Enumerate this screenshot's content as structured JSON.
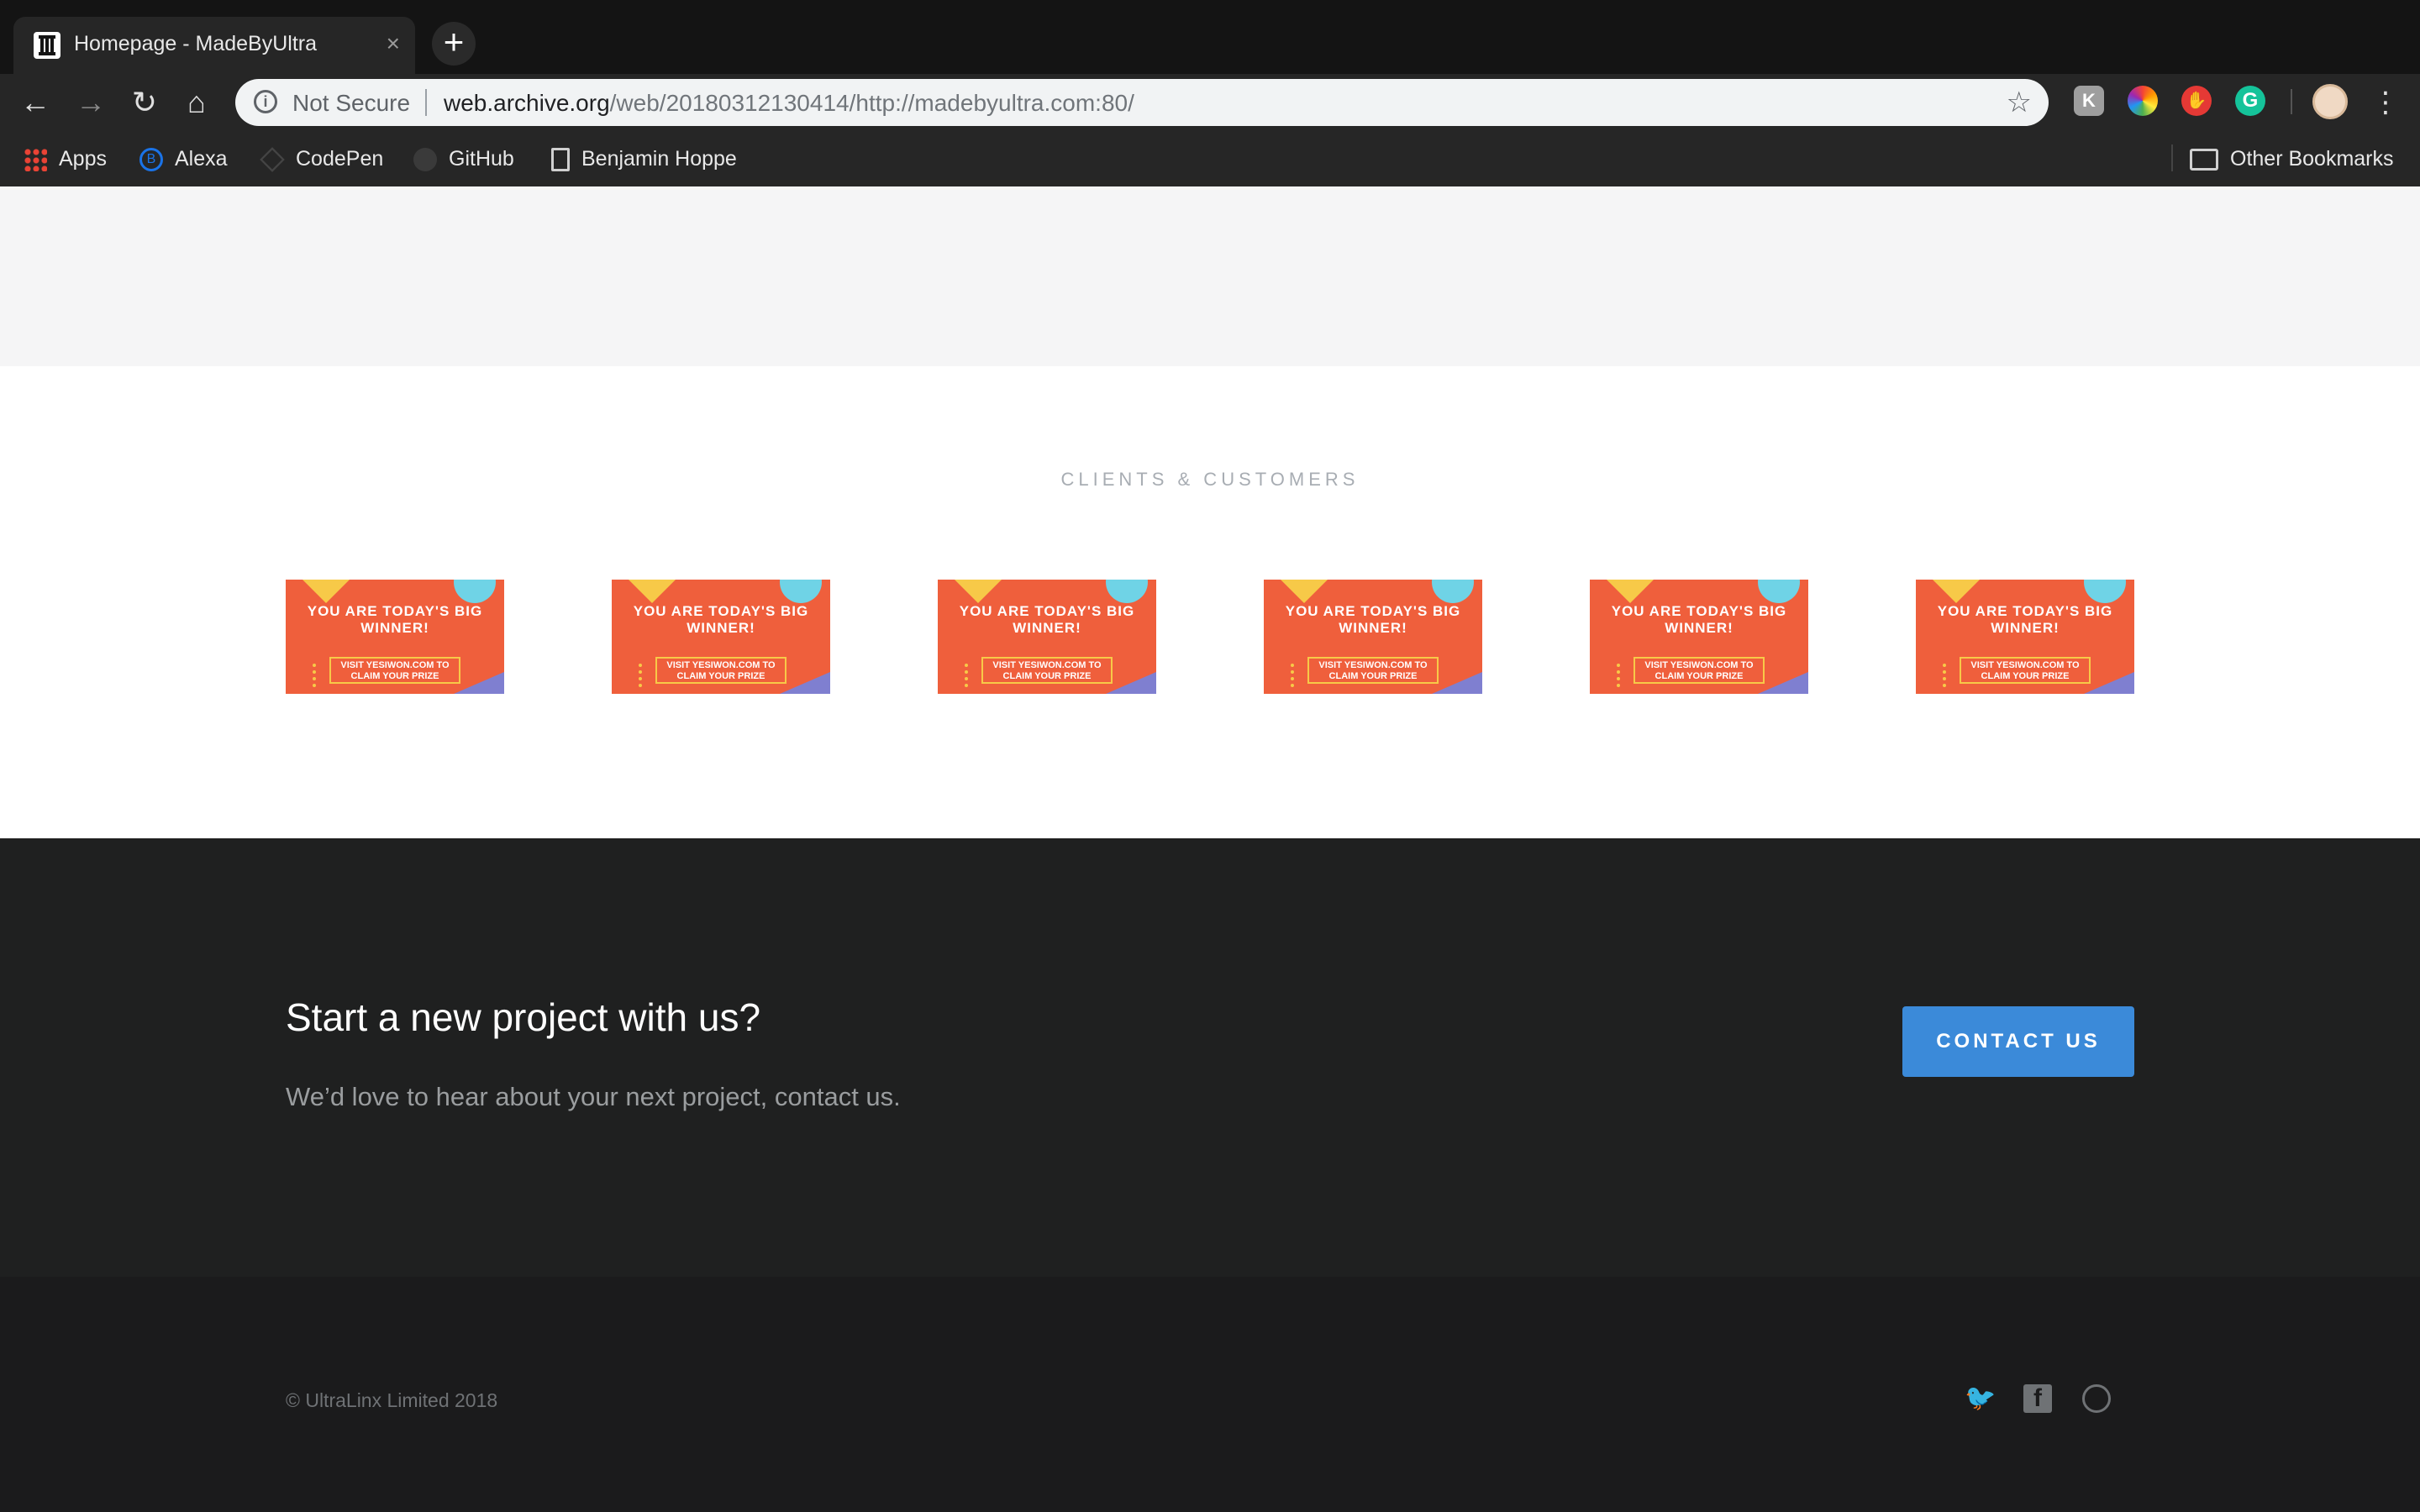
{
  "browser": {
    "tab_title": "Homepage - MadeByUltra",
    "tab_close": "×",
    "new_tab": "+",
    "back": "←",
    "forward": "→",
    "reload": "↻",
    "home": "⌂",
    "security_label": "Not Secure",
    "url_host": "web.archive.org",
    "url_path": "/web/20180312130414/http://madebyultra.com:80/",
    "star": "☆",
    "menu": "⋮",
    "extensions": [
      "K",
      "color-wheel",
      "stop",
      "G"
    ],
    "bookmarks": [
      "Apps",
      "Alexa",
      "CodePen",
      "GitHub",
      "Benjamin Hoppe"
    ],
    "other_bookmarks": "Other Bookmarks"
  },
  "clients": {
    "title": "CLIENTS & CUSTOMERS",
    "logo_headline": "YOU ARE TODAY'S BIG WINNER!",
    "logo_box": "VISIT YESIWON.COM TO CLAIM YOUR PRIZE",
    "count": 6
  },
  "cta": {
    "heading": "Start a new project with us?",
    "subtext": "We’d love to hear about your next project, contact us.",
    "button": "CONTACT US"
  },
  "footer": {
    "copyright": "© UltraLinx Limited 2018",
    "social": [
      "twitter-icon",
      "facebook-icon",
      "dribbble-icon"
    ]
  },
  "colors": {
    "accent_button": "#3b8ad9",
    "logo_bg": "#ef5f3c",
    "dark_bg": "#1f2020"
  }
}
